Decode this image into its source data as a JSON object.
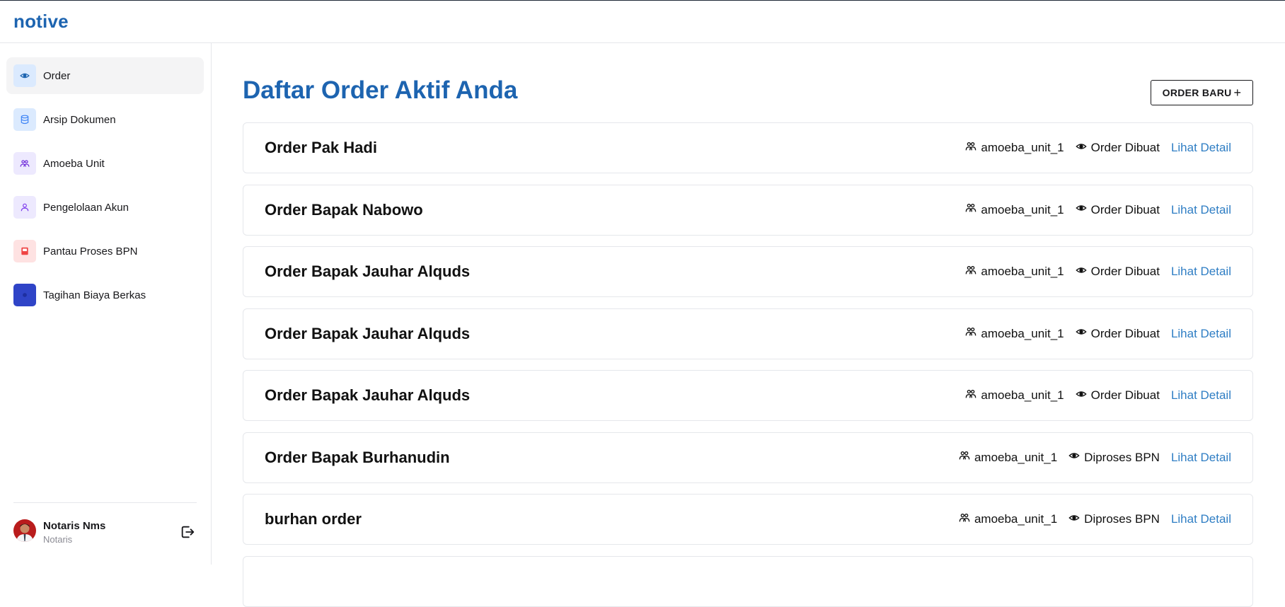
{
  "app": {
    "brand": "notive"
  },
  "sidebar": {
    "items": [
      {
        "label": "Order",
        "icon": "eye-icon",
        "bg": "#dbeafe",
        "fg": "#1d64b0",
        "active": true
      },
      {
        "label": "Arsip Dokumen",
        "icon": "database-icon",
        "bg": "#dbeafe",
        "fg": "#3b82f6",
        "active": false
      },
      {
        "label": "Amoeba Unit",
        "icon": "users-icon",
        "bg": "#ede9fe",
        "fg": "#6d28d9",
        "active": false
      },
      {
        "label": "Pengelolaan Akun",
        "icon": "user-icon",
        "bg": "#ede9fe",
        "fg": "#7c3aed",
        "active": false
      },
      {
        "label": "Pantau Proses BPN",
        "icon": "book-icon",
        "bg": "#fee2e2",
        "fg": "#ef4444",
        "active": false
      },
      {
        "label": "Tagihan Biaya Berkas",
        "icon": "receipt-icon",
        "bg": "#2f44c7",
        "fg": "#1e2fa0",
        "active": false
      }
    ],
    "user": {
      "name": "Notaris Nms",
      "role": "Notaris"
    }
  },
  "main": {
    "title": "Daftar Order Aktif Anda",
    "new_order_label": "ORDER BARU",
    "new_order_icon": "+",
    "orders": [
      {
        "title": "Order Pak Hadi",
        "unit": "amoeba_unit_1",
        "status": "Order Dibuat",
        "link": "Lihat Detail"
      },
      {
        "title": "Order Bapak Nabowo",
        "unit": "amoeba_unit_1",
        "status": "Order Dibuat",
        "link": "Lihat Detail"
      },
      {
        "title": "Order Bapak Jauhar Alquds",
        "unit": "amoeba_unit_1",
        "status": "Order Dibuat",
        "link": "Lihat Detail"
      },
      {
        "title": "Order Bapak Jauhar Alquds",
        "unit": "amoeba_unit_1",
        "status": "Order Dibuat",
        "link": "Lihat Detail"
      },
      {
        "title": "Order Bapak Jauhar Alquds",
        "unit": "amoeba_unit_1",
        "status": "Order Dibuat",
        "link": "Lihat Detail"
      },
      {
        "title": "Order Bapak Burhanudin",
        "unit": "amoeba_unit_1",
        "status": "Diproses BPN",
        "link": "Lihat Detail"
      },
      {
        "title": "burhan order",
        "unit": "amoeba_unit_1",
        "status": "Diproses BPN",
        "link": "Lihat Detail"
      }
    ]
  },
  "colors": {
    "brand": "#1d64b0",
    "link": "#2f7ec4",
    "border": "#e5e7eb"
  }
}
